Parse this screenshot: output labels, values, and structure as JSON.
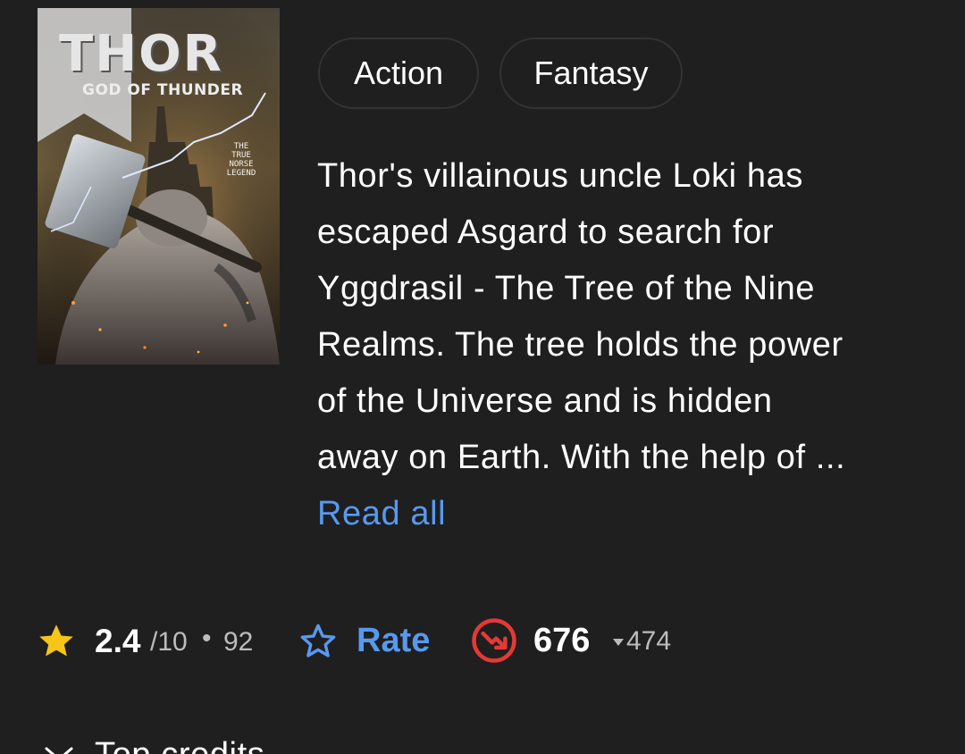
{
  "poster": {
    "title": "THOR",
    "subtitle": "GOD OF THUNDER",
    "tagline": [
      "THE",
      "TRUE",
      "NORSE",
      "LEGEND"
    ],
    "ribbon_icon": "bookmark-ribbon-icon"
  },
  "genres": [
    "Action",
    "Fantasy"
  ],
  "plot": {
    "lines": [
      "Thor's villainous uncle Loki has",
      "escaped Asgard to search for",
      "Yggdrasil - The Tree of the Nine",
      "Realms. The tree holds the power",
      "of the Universe and is hidden",
      "away on Earth. With the help of ..."
    ],
    "read_all": "Read all"
  },
  "rating": {
    "icon": "star-filled-icon",
    "value": "2.4",
    "scale": "/10",
    "separator": "•",
    "count": "92"
  },
  "rate": {
    "icon": "star-outline-icon",
    "label": "Rate"
  },
  "popularity": {
    "icon": "popularity-down-icon",
    "value": "676",
    "change_icon": "triangle-down-icon",
    "change": "474"
  },
  "next_section": {
    "icon": "chevron-down-icon",
    "label": "Top credits"
  },
  "colors": {
    "background": "#1f1f1f",
    "accent_blue": "#5799ef",
    "star_yellow": "#f5c518",
    "popularity_red": "#e53935",
    "muted_text": "#bcbcbc"
  }
}
